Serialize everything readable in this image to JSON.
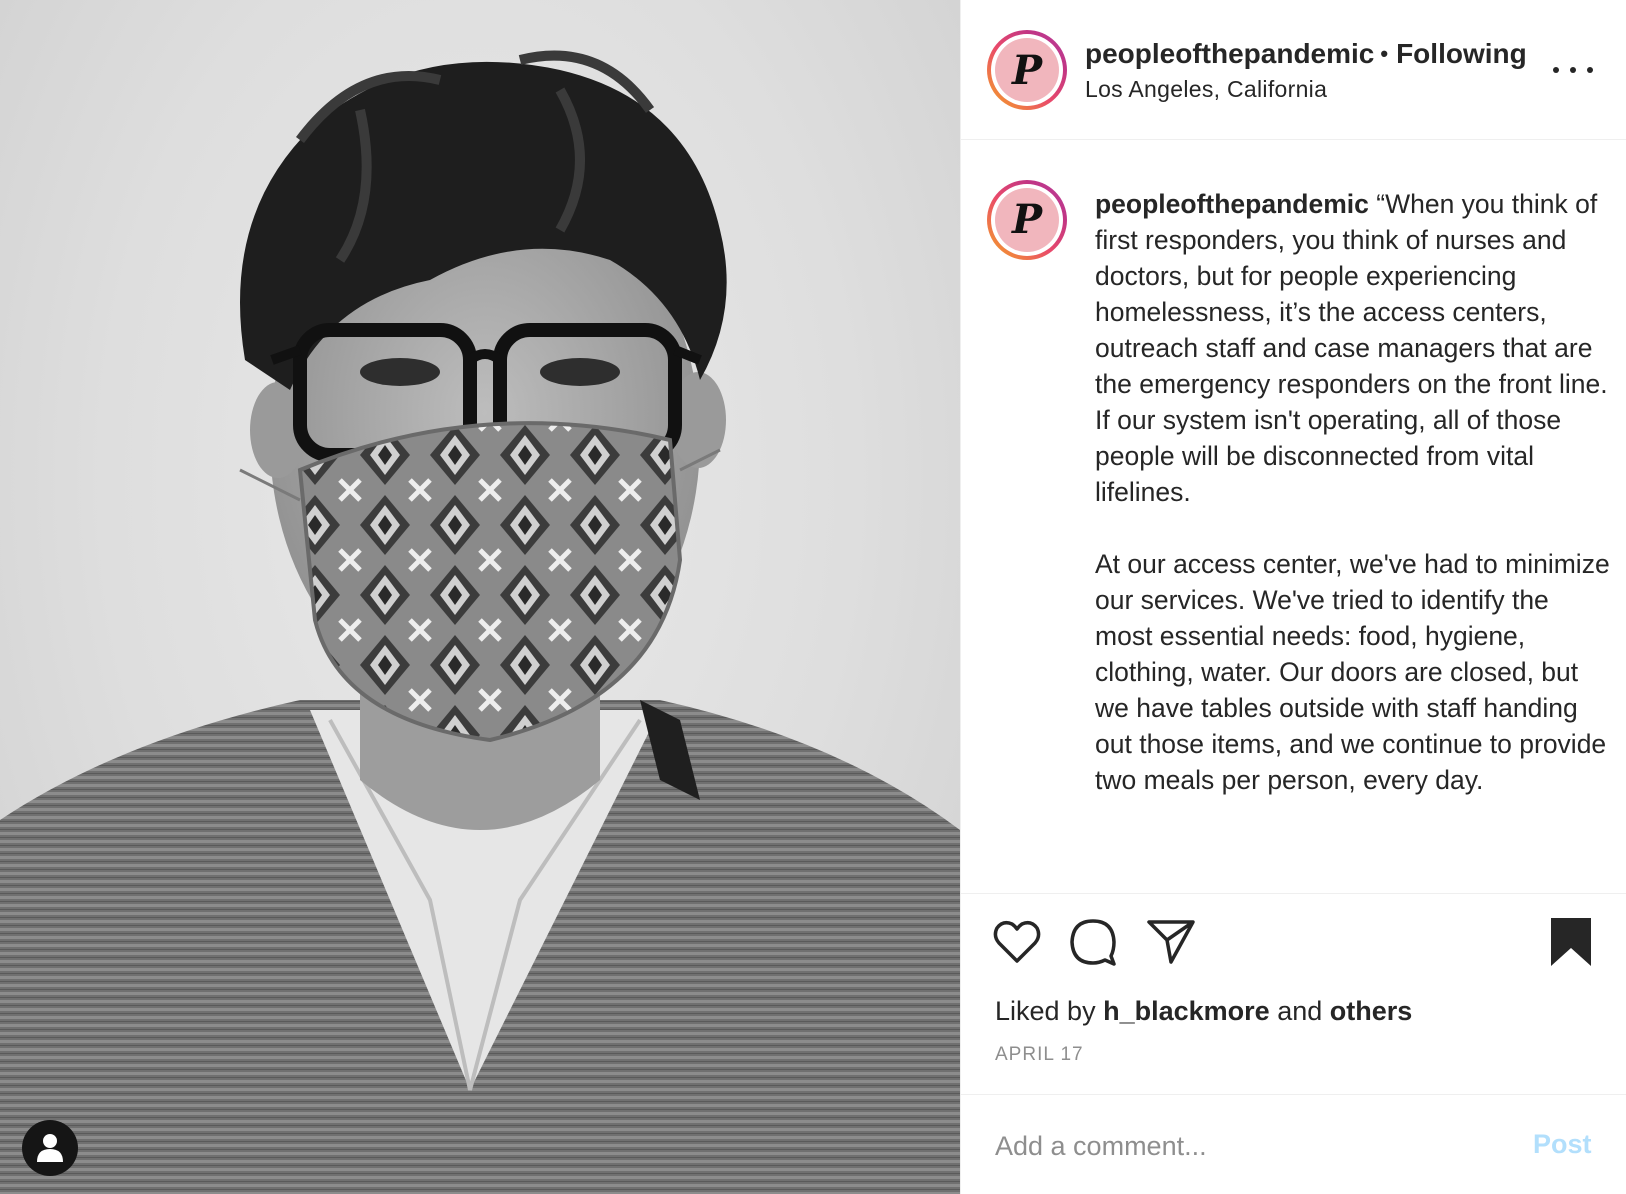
{
  "photo": {
    "alt_icon": "person-icon"
  },
  "header": {
    "username": "peopleofthepandemic",
    "separator": "•",
    "follow_status": "Following",
    "location": "Los Angeles, California",
    "avatar_letter": "P"
  },
  "caption": {
    "username": "peopleofthepandemic",
    "paragraph1": "“When you think of first responders, you think of nurses and doctors, but for people experiencing homelessness, it’s the access centers, outreach staff and case managers that are the emergency responders on the front line. If our system isn't operating, all of those people will be disconnected from vital lifelines.",
    "paragraph2": "At our access center, we've had to minimize our services. We've tried to identify the most essential needs: food, hygiene, clothing, water. Our doors are closed, but we have tables outside with staff handing out those items, and we continue to provide two meals per person, every day."
  },
  "actions": {
    "icons": [
      "heart-icon",
      "comment-icon",
      "share-icon",
      "bookmark-icon"
    ]
  },
  "likes": {
    "prefix": "Liked by",
    "user": "h_blackmore",
    "conj": "and",
    "others": "others"
  },
  "date": "APRIL 17",
  "comment": {
    "placeholder": "Add a comment...",
    "post_label": "Post"
  },
  "colors": {
    "avatar_fill": "#f1b6bd",
    "post_button_disabled": "#b2dffc",
    "muted_text": "#8e8e8e",
    "primary_text": "#262626"
  }
}
